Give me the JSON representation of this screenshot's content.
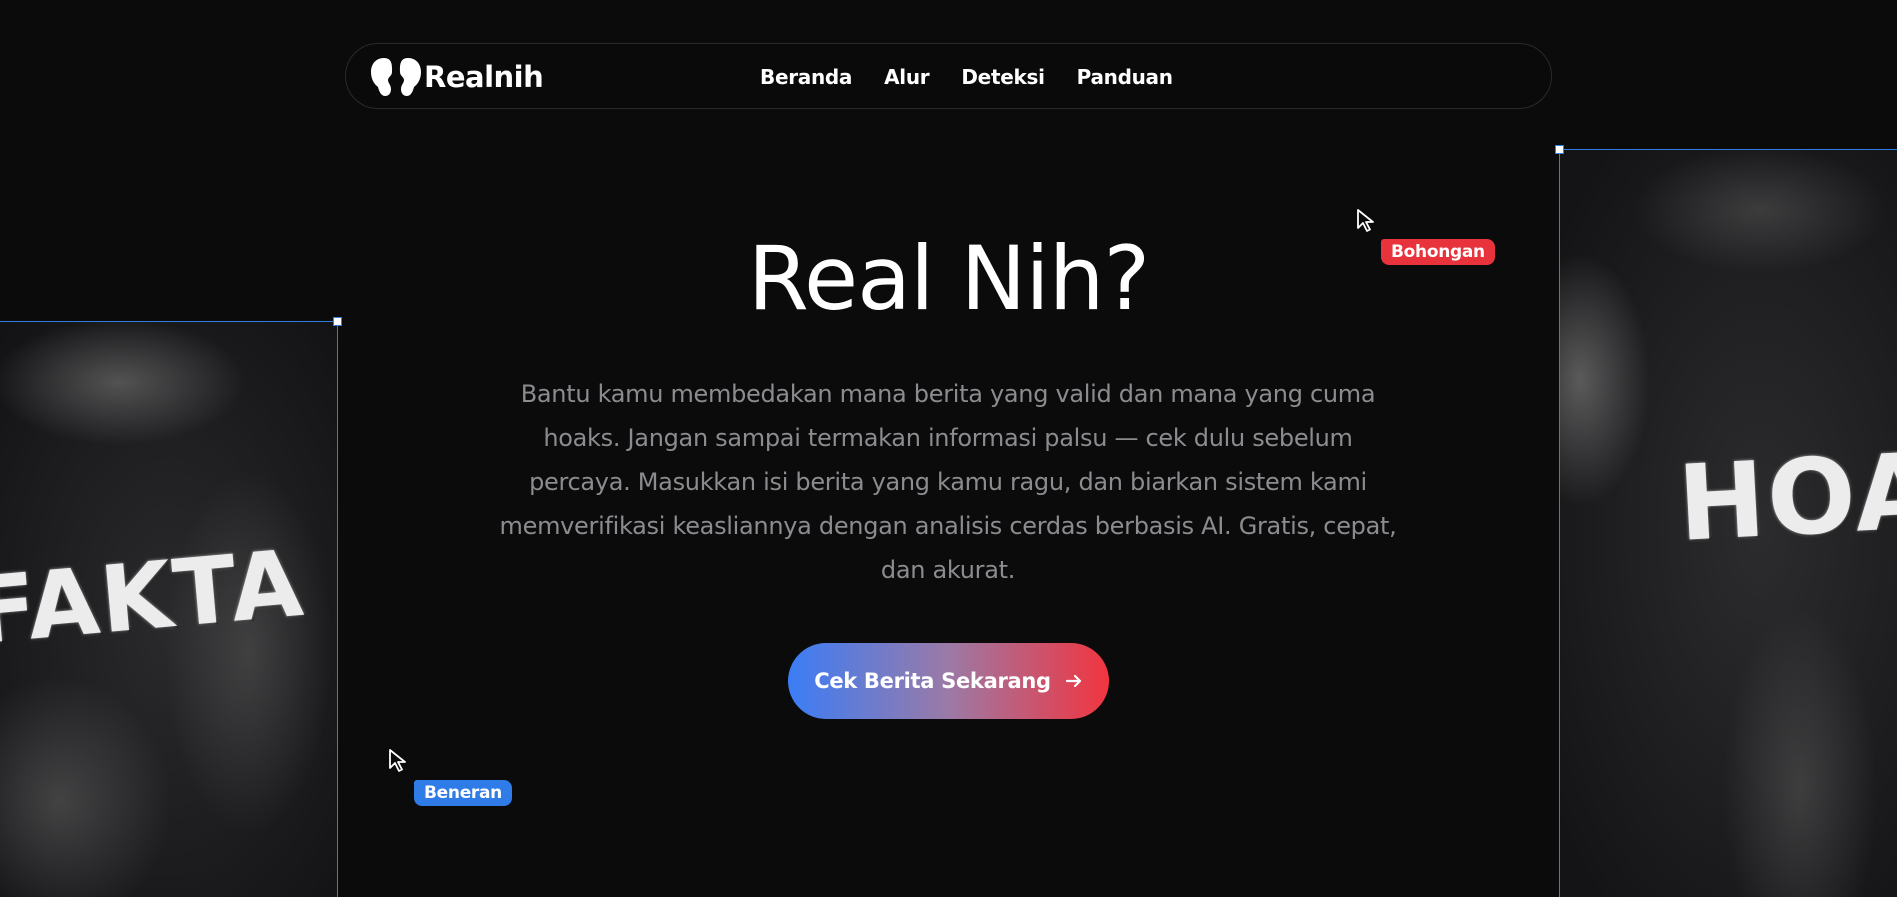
{
  "brand": {
    "name": "Realnih"
  },
  "nav": {
    "items": [
      {
        "label": "Beranda"
      },
      {
        "label": "Alur"
      },
      {
        "label": "Deteksi"
      },
      {
        "label": "Panduan"
      }
    ]
  },
  "hero": {
    "title": "Real Nih?",
    "description": "Bantu kamu membedakan mana berita yang valid dan mana yang cuma hoaks. Jangan sampai termakan informasi palsu — cek dulu sebelum percaya. Masukkan isi berita yang kamu ragu, dan biarkan sistem kami memverifikasi keasliannya dengan analisis cerdas berbasis AI. Gratis, cepat, dan akurat.",
    "cta_label": "Cek Berita Sekarang"
  },
  "side_images": {
    "left_word": "FAKTA",
    "right_word": "HOAKS"
  },
  "cursor_tags": {
    "hoax_label": "Bohongan",
    "real_label": "Beneran"
  },
  "colors": {
    "background": "#0b0b0c",
    "accent_blue": "#3b7df6",
    "accent_red": "#f1353f",
    "muted_text": "#8c8c90"
  },
  "icons": {
    "logo": "brain-silhouette-icon",
    "cta": "arrow-right-icon",
    "cursor": "pointer-cursor-icon"
  }
}
